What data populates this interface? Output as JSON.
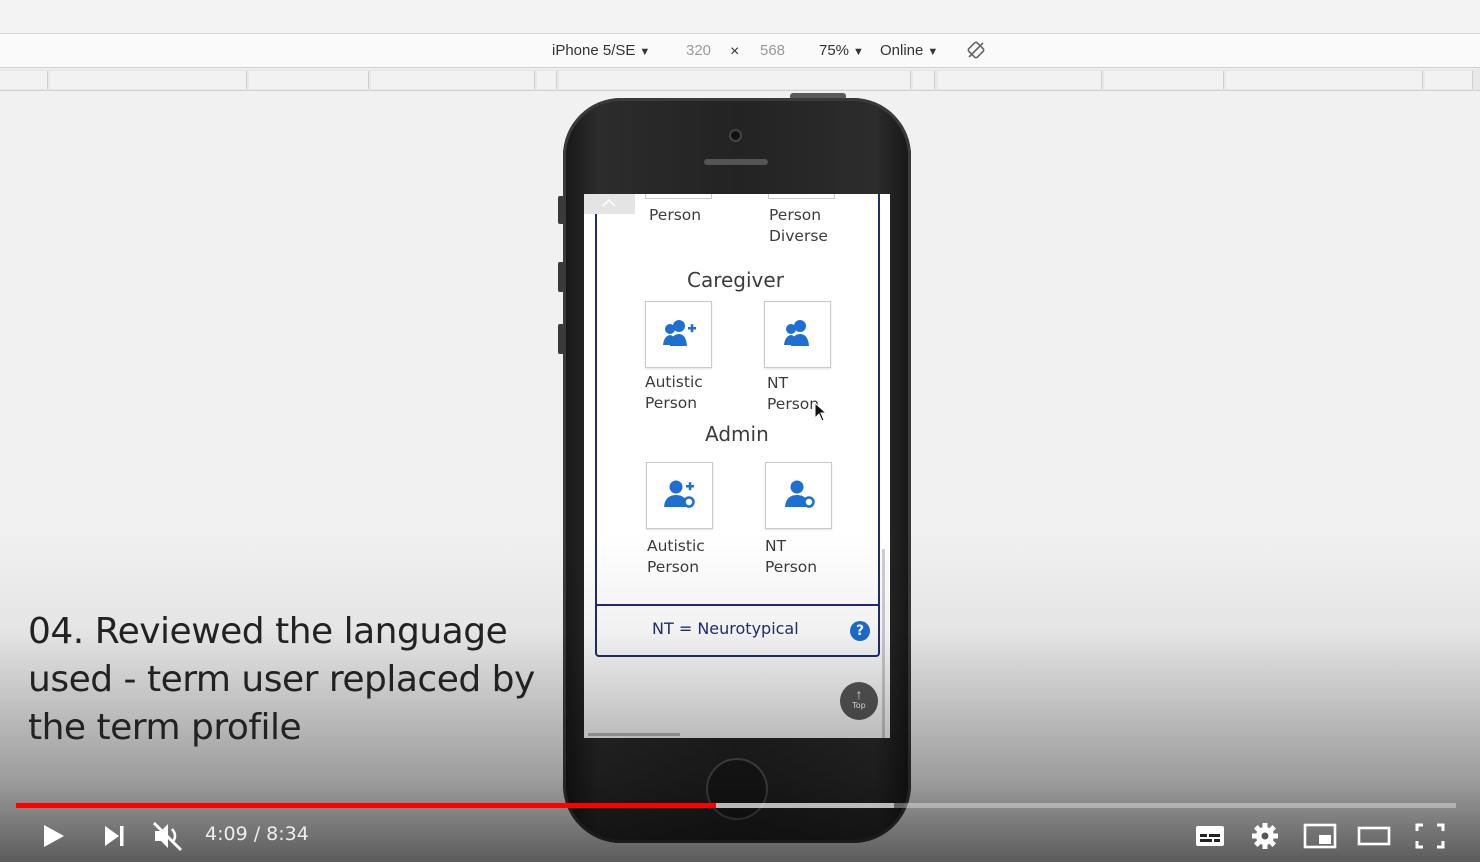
{
  "devtools": {
    "device": "iPhone 5/SE",
    "width": "320",
    "times": "×",
    "height": "568",
    "zoom": "75%",
    "network": "Online"
  },
  "app": {
    "top_labels": [
      {
        "line1": "Person",
        "line2": ""
      },
      {
        "line1": "Person",
        "line2": "Diverse"
      }
    ],
    "sections": [
      {
        "heading": "Caregiver",
        "tiles": [
          {
            "icon": "user-plus-group-icon",
            "line1": "Autistic",
            "line2": "Person"
          },
          {
            "icon": "user-group-icon",
            "line1": "NT",
            "line2": "Person"
          }
        ]
      },
      {
        "heading": "Admin",
        "tiles": [
          {
            "icon": "user-plus-gear-icon",
            "line1": "Autistic",
            "line2": "Person"
          },
          {
            "icon": "user-gear-icon",
            "line1": "NT",
            "line2": "Person"
          }
        ]
      }
    ],
    "legend": "NT = Neurotypical",
    "help_glyph": "?",
    "top_button": "Top"
  },
  "caption": "04. Reviewed the language used - term user replaced by the term profile",
  "player": {
    "current_time": "4:09",
    "separator": " / ",
    "duration": "8:34",
    "progress": 0.486,
    "buffered": 0.61,
    "accent": "#ff0000"
  }
}
